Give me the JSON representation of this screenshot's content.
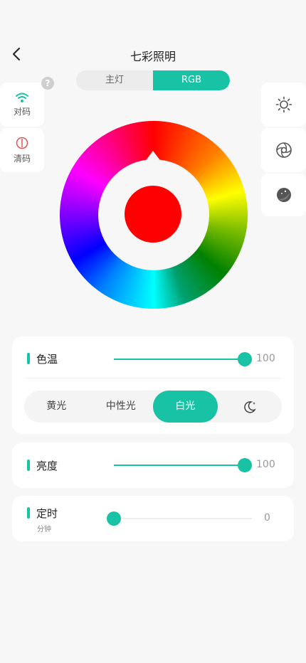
{
  "header": {
    "title": "七彩照明"
  },
  "tabs": [
    {
      "label": "主灯",
      "active": false
    },
    {
      "label": "RGB",
      "active": true
    }
  ],
  "left_actions": [
    {
      "label": "对码",
      "icon": "wifi-icon"
    },
    {
      "label": "清码",
      "icon": "power-icon"
    }
  ],
  "help_icon": "?",
  "right_actions": [
    {
      "icon": "sun-icon"
    },
    {
      "icon": "aperture-icon"
    },
    {
      "icon": "moon-stars-icon"
    }
  ],
  "color_wheel": {
    "selected_color": "#ff0000"
  },
  "color_temp": {
    "label": "色温",
    "value": "100",
    "level": 1.0,
    "modes": [
      {
        "label": "黄光",
        "active": false
      },
      {
        "label": "中性光",
        "active": false
      },
      {
        "label": "白光",
        "active": true
      },
      {
        "label": "",
        "icon": "moon-icon",
        "active": false
      }
    ]
  },
  "brightness": {
    "label": "亮度",
    "value": "100",
    "level": 1.0
  },
  "timer": {
    "label": "定时",
    "unit": "分钟",
    "value": "0",
    "level": 0.0
  },
  "colors": {
    "accent": "#18c2a5",
    "background": "#f7f7f7"
  }
}
